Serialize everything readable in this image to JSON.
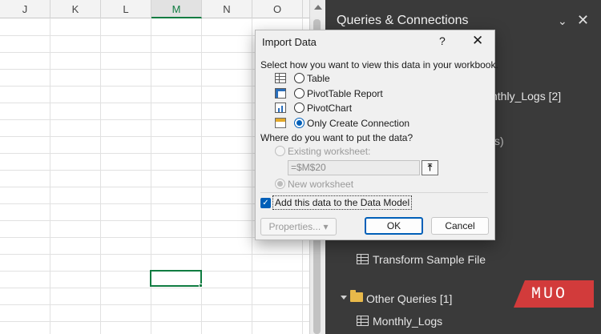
{
  "sheet": {
    "columns": [
      "J",
      "K",
      "L",
      "M",
      "N",
      "O"
    ],
    "selected_column": "M"
  },
  "queries_pane": {
    "title": "Queries & Connections",
    "items": [
      {
        "label": "nthly_Logs [2]"
      },
      {
        "label": "s)"
      },
      {
        "label": "Transform Sample File"
      },
      {
        "label": "Other Queries [1]"
      },
      {
        "label": "Monthly_Logs"
      }
    ]
  },
  "watermark": "MUO",
  "dialog": {
    "title": "Import Data",
    "help_glyph": "?",
    "close_glyph": "✕",
    "view_prompt": "Select how you want to view this data in your workbook.",
    "view_options": [
      {
        "label": "Table",
        "icon": "table-icon",
        "selected": false
      },
      {
        "label": "PivotTable Report",
        "icon": "pivottable-icon",
        "selected": false
      },
      {
        "label": "PivotChart",
        "icon": "pivotchart-icon",
        "selected": false
      },
      {
        "label": "Only Create Connection",
        "icon": "connection-icon",
        "selected": true
      }
    ],
    "location_prompt": "Where do you want to put the data?",
    "existing_worksheet_label": "Existing worksheet:",
    "cell_reference": "=$M$20",
    "new_worksheet_label": "New worksheet",
    "data_model_label": "Add this data to the Data Model",
    "data_model_checked": true,
    "properties_label": "Properties...",
    "ok_label": "OK",
    "cancel_label": "Cancel"
  },
  "colors": {
    "accent": "#005fb8",
    "excel_green": "#107c41",
    "pane_background": "#3a3a3a",
    "watermark": "#d23b3b"
  }
}
